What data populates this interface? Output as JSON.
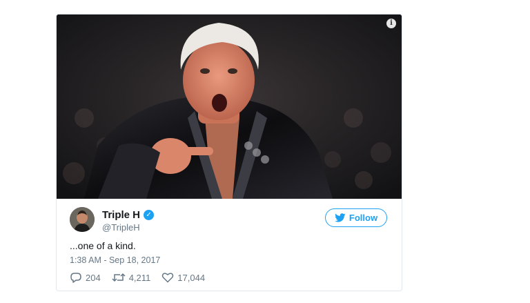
{
  "tweet": {
    "author_name": "Triple H",
    "author_handle": "@TripleH",
    "follow_label": "Follow",
    "text": "...one of a kind.",
    "timestamp": "1:38 AM - Sep 18, 2017",
    "replies": "204",
    "retweets": "4,211",
    "likes": "17,044",
    "info_glyph": "i",
    "verified_glyph": "✓"
  },
  "icons": {
    "media_info": "info-icon",
    "verified": "verified-badge-icon",
    "follow": "twitter-bird-icon",
    "reply": "reply-icon",
    "retweet": "retweet-icon",
    "like": "heart-icon"
  },
  "colors": {
    "accent": "#1da1f2",
    "text": "#14171a",
    "muted": "#657786",
    "border": "#e1e8ed"
  }
}
